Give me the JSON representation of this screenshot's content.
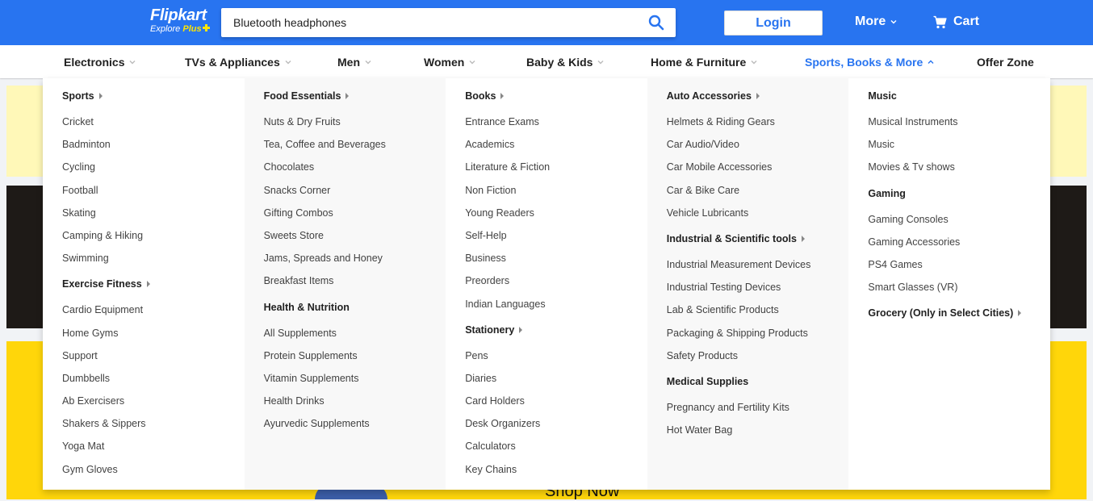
{
  "header": {
    "logo_main": "Flipkart",
    "logo_sub_explore": "Explore",
    "logo_sub_plus": "Plus",
    "search_value": "Bluetooth headphones",
    "login_label": "Login",
    "more_label": "More",
    "cart_label": "Cart",
    "brand_color": "#2874f0",
    "accent_color": "#ffe500"
  },
  "nav": {
    "items": [
      {
        "label": "Electronics"
      },
      {
        "label": "TVs & Appliances"
      },
      {
        "label": "Men"
      },
      {
        "label": "Women"
      },
      {
        "label": "Baby & Kids"
      },
      {
        "label": "Home & Furniture"
      },
      {
        "label": "Sports, Books & More",
        "active": true
      },
      {
        "label": "Offer Zone"
      }
    ]
  },
  "banner": {
    "shop_now": "Shop Now"
  },
  "menu": {
    "columns": [
      {
        "groups": [
          {
            "heading": "Sports",
            "caret": true,
            "links": [
              "Cricket",
              "Badminton",
              "Cycling",
              "Football",
              "Skating",
              "Camping & Hiking",
              "Swimming"
            ]
          },
          {
            "heading": "Exercise Fitness",
            "caret": true,
            "links": [
              "Cardio Equipment",
              "Home Gyms",
              "Support",
              "Dumbbells",
              "Ab Exercisers",
              "Shakers & Sippers",
              "Yoga Mat",
              "Gym Gloves"
            ]
          }
        ]
      },
      {
        "groups": [
          {
            "heading": "Food Essentials",
            "caret": true,
            "links": [
              "Nuts & Dry Fruits",
              "Tea, Coffee and Beverages",
              "Chocolates",
              "Snacks Corner",
              "Gifting Combos",
              "Sweets Store",
              "Jams, Spreads and Honey",
              "Breakfast Items"
            ]
          },
          {
            "heading": "Health & Nutrition",
            "caret": false,
            "links": [
              "All Supplements",
              "Protein Supplements",
              "Vitamin Supplements",
              "Health Drinks",
              "Ayurvedic Supplements"
            ]
          }
        ]
      },
      {
        "groups": [
          {
            "heading": "Books",
            "caret": true,
            "links": [
              "Entrance Exams",
              "Academics",
              "Literature & Fiction",
              "Non Fiction",
              "Young Readers",
              "Self-Help",
              "Business",
              "Preorders",
              "Indian Languages"
            ]
          },
          {
            "heading": "Stationery",
            "caret": true,
            "links": [
              "Pens",
              "Diaries",
              "Card Holders",
              "Desk Organizers",
              "Calculators",
              "Key Chains"
            ]
          }
        ]
      },
      {
        "groups": [
          {
            "heading": "Auto Accessories",
            "caret": true,
            "links": [
              "Helmets & Riding Gears",
              "Car Audio/Video",
              "Car Mobile Accessories",
              "Car & Bike Care",
              "Vehicle Lubricants"
            ]
          },
          {
            "heading": "Industrial & Scientific tools",
            "caret": true,
            "links": [
              "Industrial Measurement Devices",
              "Industrial Testing Devices",
              "Lab & Scientific Products",
              "Packaging & Shipping Products",
              "Safety Products"
            ]
          },
          {
            "heading": "Medical Supplies",
            "caret": false,
            "links": [
              "Pregnancy and Fertility Kits",
              "Hot Water Bag"
            ]
          }
        ]
      },
      {
        "groups": [
          {
            "heading": "Music",
            "caret": false,
            "links": [
              "Musical Instruments",
              "Music",
              "Movies & Tv shows"
            ]
          },
          {
            "heading": "Gaming",
            "caret": false,
            "links": [
              "Gaming Consoles",
              "Gaming Accessories",
              "PS4 Games",
              "Smart Glasses (VR)"
            ]
          },
          {
            "heading": "Grocery (Only in Select Cities)",
            "caret": true,
            "links": []
          }
        ]
      }
    ]
  }
}
